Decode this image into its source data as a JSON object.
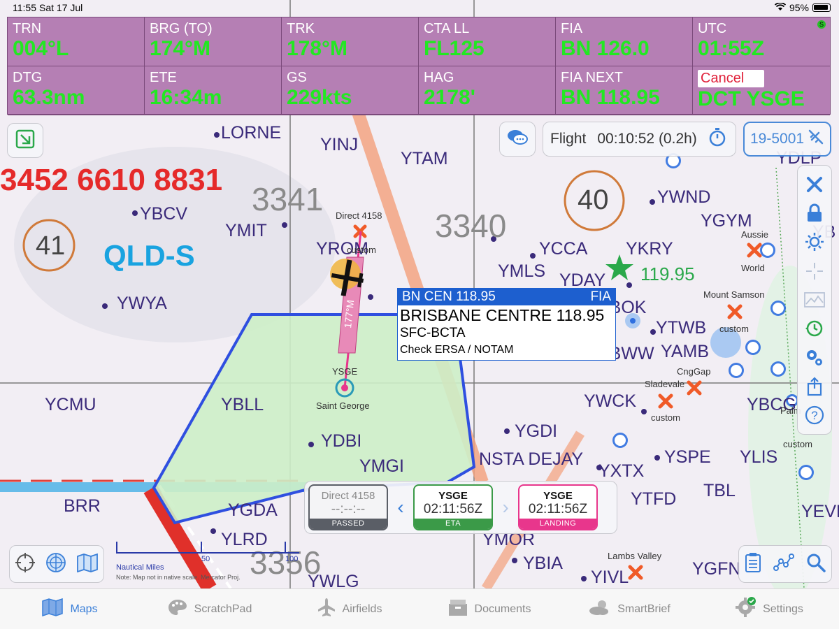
{
  "status": {
    "time": "11:55",
    "date": "Sat 17 Jul",
    "battery": "95%"
  },
  "panel": {
    "cells": [
      {
        "label": "TRN",
        "value": "004°L"
      },
      {
        "label": "BRG (TO)",
        "value": "174°M"
      },
      {
        "label": "TRK",
        "value": "178°M"
      },
      {
        "label": "CTA LL",
        "value": "FL125"
      },
      {
        "label": "FIA",
        "value": "BN 126.0"
      },
      {
        "label": "UTC",
        "value": "01:55Z"
      },
      {
        "label": "DTG",
        "value": "63.3nm"
      },
      {
        "label": "ETE",
        "value": "16:34m"
      },
      {
        "label": "GS",
        "value": "229kts"
      },
      {
        "label": "HAG",
        "value": "2178'"
      },
      {
        "label": "FIA NEXT",
        "value": "BN 118.95"
      }
    ],
    "cancel_label": "Cancel",
    "direct_value": "DCT YSGE",
    "status_dot": "S"
  },
  "flight": {
    "label": "Flight",
    "timer": "00:10:52 (0.2h)",
    "aircraft_id": "19-5001"
  },
  "popup": {
    "header_left": "BN CEN 118.95",
    "header_right": "FIA",
    "line1": "BRISBANE CENTRE 118.95",
    "line2": "SFC-BCTA",
    "line3": "Check ERSA / NOTAM"
  },
  "strip": {
    "passed": {
      "name": "Direct 4158",
      "time": "--:--:--",
      "status": "PASSED"
    },
    "eta": {
      "name": "YSGE",
      "time": "02:11:56Z",
      "status": "ETA"
    },
    "landing": {
      "name": "YSGE",
      "time": "02:11:56Z",
      "status": "LANDING"
    }
  },
  "scale": {
    "t50": "50",
    "t100": "100",
    "units": "Nautical Miles",
    "note": "Note: Map not in native scale. Mercator Proj."
  },
  "map": {
    "labels": {
      "lorne": "LORNE",
      "yinj": "YINJ",
      "ytam": "YTAM",
      "ybcv": "YBCV",
      "ymit": "YMIT",
      "yrom": "YROM",
      "ymls": "YMLS",
      "ycca": "YCCA",
      "ykry": "YKRY",
      "yday": "YDAY",
      "ywnd": "YWND",
      "ygym": "YGYM",
      "ywya": "YWYA",
      "ycmu": "YCMU",
      "ybll": "YBLL",
      "ydbi": "YDBI",
      "ymgi": "YMGI",
      "yssge": "YSGE",
      "ytwb": "YTWB",
      "yamb": "YAMB",
      "ybok": "YBOK",
      "ybww": "YBWW",
      "ywck": "YWCK",
      "ygdi": "YGDI",
      "nsta": "NSTA DEJAY",
      "yspe": "YSPE",
      "ylis": "YLIS",
      "yxtx": "YXTX",
      "ytfd": "YTFD",
      "tbl": "TBL",
      "ybcg": "YBCG",
      "yevd": "YEVD",
      "brr": "BRR",
      "ygda": "YGDA",
      "ylrd": "YLRD",
      "ymor": "YMOR",
      "ybia": "YBIA",
      "yivl": "YIVL",
      "ygfn": "YGFN",
      "ywlg": "YWLG",
      "qlds": "QLD-S",
      "g3341": "3341",
      "g3340": "3340",
      "g3356": "3356",
      "ref": "3452 6610 8831",
      "c41": "41",
      "c40": "40",
      "freq": "119.95",
      "direct4158": "Direct 4158",
      "custom1": "custom",
      "ysge_small": "YSGE",
      "saint_george": "Saint George",
      "aussie": "Aussie",
      "world": "World",
      "mount_samson": "Mount Samson",
      "custom2": "custom",
      "cnggap": "CngGap",
      "sladevale": "Sladevale",
      "custom3": "custom",
      "palm": "Palm",
      "custom4": "custom",
      "lambs_valley": "Lambs Valley",
      "ydby": "YB",
      "ydlp": "YDLP"
    }
  },
  "tabs": [
    {
      "label": "Maps",
      "active": true
    },
    {
      "label": "ScratchPad"
    },
    {
      "label": "Airfields"
    },
    {
      "label": "Documents"
    },
    {
      "label": "SmartBrief"
    },
    {
      "label": "Settings"
    }
  ],
  "colors": {
    "panel_bg": "#b57fb4",
    "value_green": "#22e822",
    "route_pink": "#e8368c",
    "zone_blue": "#2f4fe0",
    "zone_fill": "#cdeec8",
    "accent": "#3a7fd8"
  }
}
